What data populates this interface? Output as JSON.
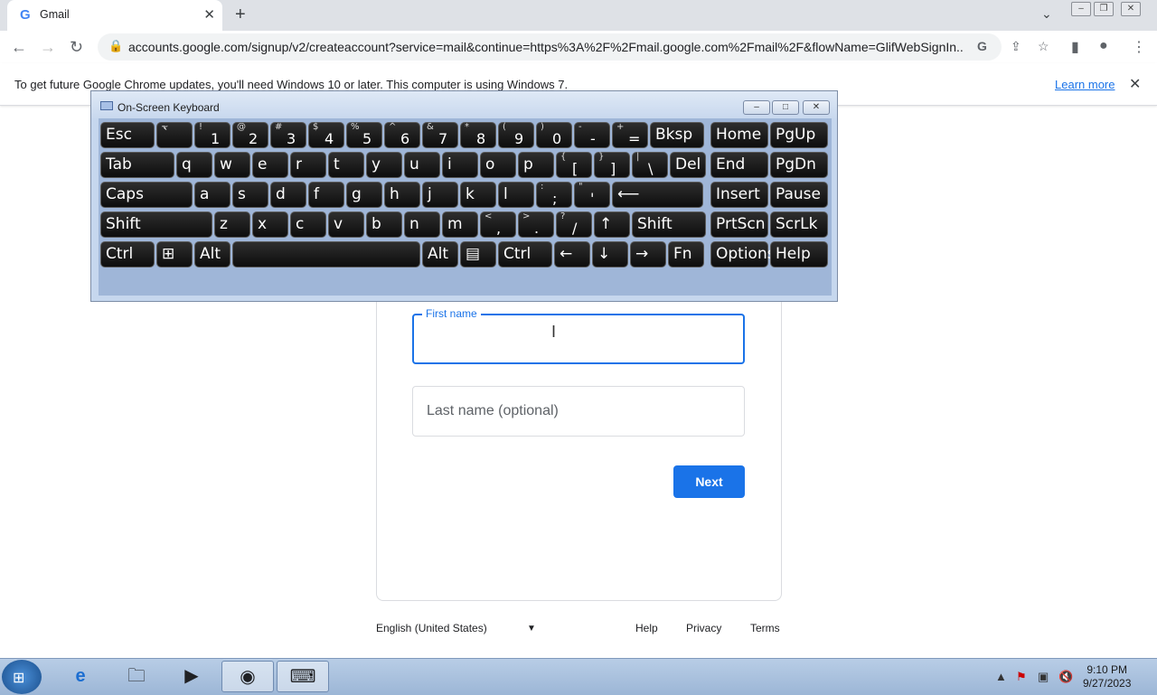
{
  "browser": {
    "tab_title": "Gmail",
    "tab_favicon": "G",
    "url": "accounts.google.com/signup/v2/createaccount?service=mail&continue=https%3A%2F%2Fmail.google.com%2Fmail%2F&flowName=GlifWebSignIn...",
    "infobar_message": "To get future Google Chrome updates, you'll need Windows 10 or later. This computer is using Windows 7.",
    "infobar_link": "Learn more"
  },
  "osk": {
    "title": "On-Screen Keyboard",
    "rows": [
      [
        {
          "main": "Esc"
        },
        {
          "sub": "~",
          "main": "`",
          "dig": ""
        },
        {
          "sub": "!",
          "dig": "1"
        },
        {
          "sub": "@",
          "dig": "2"
        },
        {
          "sub": "#",
          "dig": "3"
        },
        {
          "sub": "$",
          "dig": "4"
        },
        {
          "sub": "%",
          "dig": "5"
        },
        {
          "sub": "^",
          "dig": "6"
        },
        {
          "sub": "&",
          "dig": "7"
        },
        {
          "sub": "*",
          "dig": "8"
        },
        {
          "sub": "(",
          "dig": "9"
        },
        {
          "sub": ")",
          "dig": "0"
        },
        {
          "sub": "-",
          "dig": "-"
        },
        {
          "sub": "+",
          "dig": "="
        },
        {
          "main": "Bksp"
        },
        {
          "main": "Home"
        },
        {
          "main": "PgUp"
        }
      ],
      [
        {
          "main": "Tab"
        },
        {
          "main": "q"
        },
        {
          "main": "w"
        },
        {
          "main": "e"
        },
        {
          "main": "r"
        },
        {
          "main": "t"
        },
        {
          "main": "y"
        },
        {
          "main": "u"
        },
        {
          "main": "i"
        },
        {
          "main": "o"
        },
        {
          "main": "p"
        },
        {
          "sub": "{",
          "dig": "["
        },
        {
          "sub": "}",
          "dig": "]"
        },
        {
          "sub": "|",
          "dig": "\\"
        },
        {
          "main": "Del"
        },
        {
          "main": "End"
        },
        {
          "main": "PgDn"
        }
      ],
      [
        {
          "main": "Caps"
        },
        {
          "main": "a"
        },
        {
          "main": "s"
        },
        {
          "main": "d"
        },
        {
          "main": "f"
        },
        {
          "main": "g"
        },
        {
          "main": "h"
        },
        {
          "main": "j"
        },
        {
          "main": "k"
        },
        {
          "main": "l"
        },
        {
          "sub": ":",
          "dig": ";"
        },
        {
          "sub": "\"",
          "dig": "'"
        },
        {
          "main": "⟵"
        },
        {
          "main": "Insert"
        },
        {
          "main": "Pause"
        }
      ],
      [
        {
          "main": "Shift"
        },
        {
          "main": "z"
        },
        {
          "main": "x"
        },
        {
          "main": "c"
        },
        {
          "main": "v"
        },
        {
          "main": "b"
        },
        {
          "main": "n"
        },
        {
          "main": "m"
        },
        {
          "sub": "<",
          "dig": ","
        },
        {
          "sub": ">",
          "dig": "."
        },
        {
          "sub": "?",
          "dig": "/"
        },
        {
          "main": "↑"
        },
        {
          "main": "Shift"
        },
        {
          "main": "PrtScn"
        },
        {
          "main": "ScrLk"
        }
      ],
      [
        {
          "main": "Ctrl"
        },
        {
          "main": "⊞"
        },
        {
          "main": "Alt"
        },
        {
          "main": ""
        },
        {
          "main": "Alt"
        },
        {
          "main": "▤"
        },
        {
          "main": "Ctrl"
        },
        {
          "main": "←"
        },
        {
          "main": "↓"
        },
        {
          "main": "→"
        },
        {
          "main": "Fn"
        },
        {
          "main": "Options"
        },
        {
          "main": "Help"
        }
      ]
    ]
  },
  "form": {
    "first_name_label": "First name",
    "last_name_placeholder": "Last name (optional)",
    "next_label": "Next"
  },
  "footer": {
    "language": "English (United States)",
    "help": "Help",
    "privacy": "Privacy",
    "terms": "Terms"
  },
  "taskbar": {
    "time": "9:10 PM",
    "date": "9/27/2023"
  }
}
